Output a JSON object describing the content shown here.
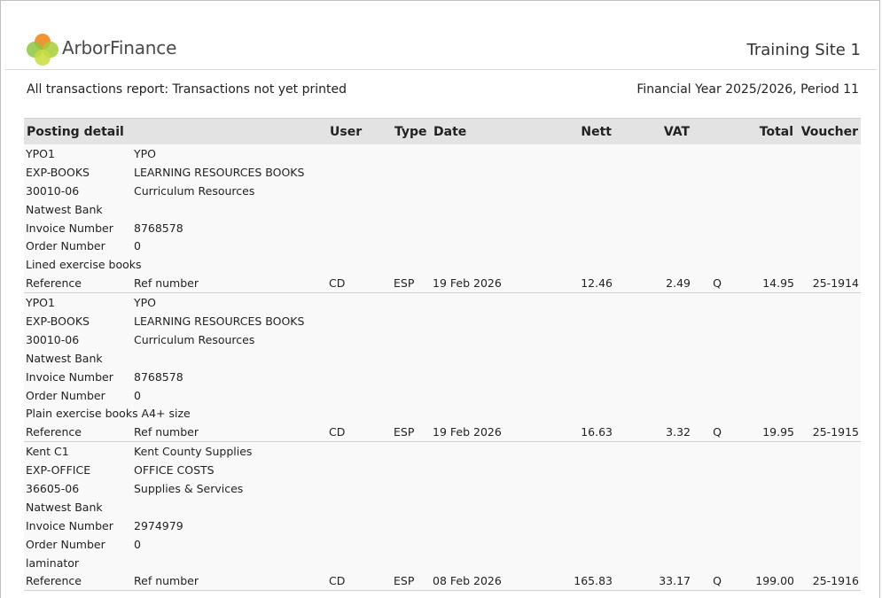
{
  "brand": {
    "name": "ArborFinance"
  },
  "site_name": "Training Site 1",
  "report_title": "All transactions report: Transactions not yet printed",
  "period": "Financial Year 2025/2026, Period 11",
  "columns": {
    "posting_detail": "Posting detail",
    "user": "User",
    "type": "Type",
    "date": "Date",
    "nett": "Nett",
    "vat": "VAT",
    "total": "Total",
    "voucher": "Voucher"
  },
  "transactions": [
    {
      "details": [
        [
          "YPO1",
          "YPO"
        ],
        [
          "EXP-BOOKS",
          "LEARNING RESOURCES BOOKS"
        ],
        [
          "30010-06",
          "Curriculum Resources"
        ],
        [
          "Natwest Bank",
          ""
        ],
        [
          "Invoice Number",
          "8768578"
        ],
        [
          "Order Number",
          "0"
        ]
      ],
      "description": "Lined exercise books",
      "reference_label": "Reference",
      "reference_value": "Ref number",
      "user": "CD",
      "type": "ESP",
      "date": "19 Feb 2026",
      "nett": "12.46",
      "vat": "2.49",
      "vat_code": "Q",
      "total": "14.95",
      "voucher": "25-1914"
    },
    {
      "details": [
        [
          "YPO1",
          "YPO"
        ],
        [
          "EXP-BOOKS",
          "LEARNING RESOURCES BOOKS"
        ],
        [
          "30010-06",
          "Curriculum Resources"
        ],
        [
          "Natwest Bank",
          ""
        ],
        [
          "Invoice Number",
          "8768578"
        ],
        [
          "Order Number",
          "0"
        ]
      ],
      "description": "Plain exercise books A4+ size",
      "reference_label": "Reference",
      "reference_value": "Ref number",
      "user": "CD",
      "type": "ESP",
      "date": "19 Feb 2026",
      "nett": "16.63",
      "vat": "3.32",
      "vat_code": "Q",
      "total": "19.95",
      "voucher": "25-1915"
    },
    {
      "details": [
        [
          "Kent C1",
          "Kent County Supplies"
        ],
        [
          "EXP-OFFICE",
          "OFFICE COSTS"
        ],
        [
          "36605-06",
          "Supplies & Services"
        ],
        [
          "Natwest Bank",
          ""
        ],
        [
          "Invoice Number",
          "2974979"
        ],
        [
          "Order Number",
          "0"
        ]
      ],
      "description": "laminator",
      "reference_label": "Reference",
      "reference_value": "Ref number",
      "user": "CD",
      "type": "ESP",
      "date": "08 Feb 2026",
      "nett": "165.83",
      "vat": "33.17",
      "vat_code": "Q",
      "total": "199.00",
      "voucher": "25-1916"
    }
  ]
}
